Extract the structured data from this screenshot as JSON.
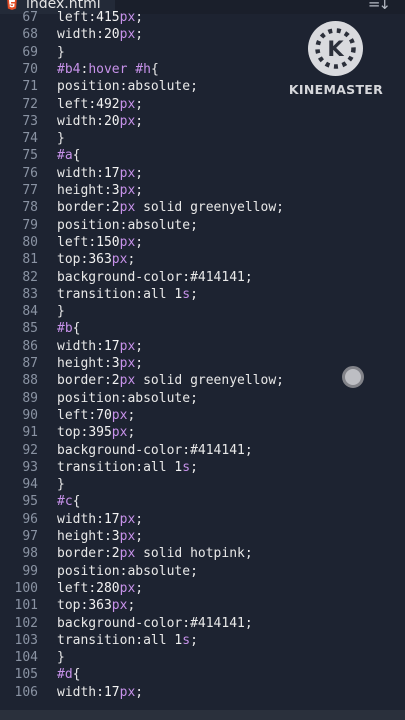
{
  "tab": {
    "title": "index.html",
    "icon": "html5-icon"
  },
  "toolbar": {
    "sort_icon": "sort-down-icon",
    "sort_glyph": "=↓"
  },
  "watermark": {
    "text": "KINEMASTER",
    "letter": "K",
    "icon": "kinemaster-logo-icon"
  },
  "editor": {
    "lines": [
      {
        "n": "67",
        "tokens": [
          [
            "prop",
            "left"
          ],
          [
            "punc",
            ":"
          ],
          [
            "num",
            "415"
          ],
          [
            "unit",
            "px"
          ],
          [
            "punc",
            ";"
          ]
        ]
      },
      {
        "n": "68",
        "tokens": [
          [
            "prop",
            "width"
          ],
          [
            "punc",
            ":"
          ],
          [
            "num",
            "20"
          ],
          [
            "unit",
            "px"
          ],
          [
            "punc",
            ";"
          ]
        ]
      },
      {
        "n": "69",
        "tokens": [
          [
            "punc",
            "}"
          ]
        ]
      },
      {
        "n": "70",
        "tokens": [
          [
            "sel",
            "#b4"
          ],
          [
            "punc",
            ":"
          ],
          [
            "sel",
            "hover"
          ],
          [
            "punc",
            " "
          ],
          [
            "sel",
            "#h"
          ],
          [
            "punc",
            "{"
          ]
        ]
      },
      {
        "n": "71",
        "tokens": [
          [
            "prop",
            "position"
          ],
          [
            "punc",
            ":"
          ],
          [
            "val",
            "absolute"
          ],
          [
            "punc",
            ";"
          ]
        ]
      },
      {
        "n": "72",
        "tokens": [
          [
            "prop",
            "left"
          ],
          [
            "punc",
            ":"
          ],
          [
            "num",
            "492"
          ],
          [
            "unit",
            "px"
          ],
          [
            "punc",
            ";"
          ]
        ]
      },
      {
        "n": "73",
        "tokens": [
          [
            "prop",
            "width"
          ],
          [
            "punc",
            ":"
          ],
          [
            "num",
            "20"
          ],
          [
            "unit",
            "px"
          ],
          [
            "punc",
            ";"
          ]
        ]
      },
      {
        "n": "74",
        "tokens": [
          [
            "punc",
            "}"
          ]
        ]
      },
      {
        "n": "75",
        "tokens": [
          [
            "sel",
            "#a"
          ],
          [
            "punc",
            "{"
          ]
        ]
      },
      {
        "n": "76",
        "tokens": [
          [
            "prop",
            "width"
          ],
          [
            "punc",
            ":"
          ],
          [
            "num",
            "17"
          ],
          [
            "unit",
            "px"
          ],
          [
            "punc",
            ";"
          ]
        ]
      },
      {
        "n": "77",
        "tokens": [
          [
            "prop",
            "height"
          ],
          [
            "punc",
            ":"
          ],
          [
            "num",
            "3"
          ],
          [
            "unit",
            "px"
          ],
          [
            "punc",
            ";"
          ]
        ]
      },
      {
        "n": "78",
        "tokens": [
          [
            "prop",
            "border"
          ],
          [
            "punc",
            ":"
          ],
          [
            "num",
            "2"
          ],
          [
            "unit",
            "px"
          ],
          [
            "val",
            " solid greenyellow"
          ],
          [
            "punc",
            ";"
          ]
        ]
      },
      {
        "n": "79",
        "tokens": [
          [
            "prop",
            "position"
          ],
          [
            "punc",
            ":"
          ],
          [
            "val",
            "absolute"
          ],
          [
            "punc",
            ";"
          ]
        ]
      },
      {
        "n": "80",
        "tokens": [
          [
            "prop",
            "left"
          ],
          [
            "punc",
            ":"
          ],
          [
            "num",
            "150"
          ],
          [
            "unit",
            "px"
          ],
          [
            "punc",
            ";"
          ]
        ]
      },
      {
        "n": "81",
        "tokens": [
          [
            "prop",
            "top"
          ],
          [
            "punc",
            ":"
          ],
          [
            "num",
            "363"
          ],
          [
            "unit",
            "px"
          ],
          [
            "punc",
            ";"
          ]
        ]
      },
      {
        "n": "82",
        "tokens": [
          [
            "prop",
            "background-color"
          ],
          [
            "punc",
            ":"
          ],
          [
            "val",
            "#414141"
          ],
          [
            "punc",
            ";"
          ]
        ]
      },
      {
        "n": "83",
        "tokens": [
          [
            "prop",
            "transition"
          ],
          [
            "punc",
            ":"
          ],
          [
            "val",
            "all "
          ],
          [
            "num",
            "1"
          ],
          [
            "unit",
            "s"
          ],
          [
            "punc",
            ";"
          ]
        ]
      },
      {
        "n": "84",
        "tokens": [
          [
            "punc",
            "}"
          ]
        ]
      },
      {
        "n": "85",
        "tokens": [
          [
            "sel",
            "#b"
          ],
          [
            "punc",
            "{"
          ]
        ]
      },
      {
        "n": "86",
        "tokens": [
          [
            "prop",
            "width"
          ],
          [
            "punc",
            ":"
          ],
          [
            "num",
            "17"
          ],
          [
            "unit",
            "px"
          ],
          [
            "punc",
            ";"
          ]
        ]
      },
      {
        "n": "87",
        "tokens": [
          [
            "prop",
            "height"
          ],
          [
            "punc",
            ":"
          ],
          [
            "num",
            "3"
          ],
          [
            "unit",
            "px"
          ],
          [
            "punc",
            ";"
          ]
        ]
      },
      {
        "n": "88",
        "tokens": [
          [
            "prop",
            "border"
          ],
          [
            "punc",
            ":"
          ],
          [
            "num",
            "2"
          ],
          [
            "unit",
            "px"
          ],
          [
            "val",
            " solid greenyellow"
          ],
          [
            "punc",
            ";"
          ]
        ]
      },
      {
        "n": "89",
        "tokens": [
          [
            "prop",
            "position"
          ],
          [
            "punc",
            ":"
          ],
          [
            "val",
            "absolute"
          ],
          [
            "punc",
            ";"
          ]
        ]
      },
      {
        "n": "90",
        "tokens": [
          [
            "prop",
            "left"
          ],
          [
            "punc",
            ":"
          ],
          [
            "num",
            "70"
          ],
          [
            "unit",
            "px"
          ],
          [
            "punc",
            ";"
          ]
        ]
      },
      {
        "n": "91",
        "tokens": [
          [
            "prop",
            "top"
          ],
          [
            "punc",
            ":"
          ],
          [
            "num",
            "395"
          ],
          [
            "unit",
            "px"
          ],
          [
            "punc",
            ";"
          ]
        ]
      },
      {
        "n": "92",
        "tokens": [
          [
            "prop",
            "background-color"
          ],
          [
            "punc",
            ":"
          ],
          [
            "val",
            "#414141"
          ],
          [
            "punc",
            ";"
          ]
        ]
      },
      {
        "n": "93",
        "tokens": [
          [
            "prop",
            "transition"
          ],
          [
            "punc",
            ":"
          ],
          [
            "val",
            "all "
          ],
          [
            "num",
            "1"
          ],
          [
            "unit",
            "s"
          ],
          [
            "punc",
            ";"
          ]
        ]
      },
      {
        "n": "94",
        "tokens": [
          [
            "punc",
            "}"
          ]
        ]
      },
      {
        "n": "95",
        "tokens": [
          [
            "sel",
            "#c"
          ],
          [
            "punc",
            "{"
          ]
        ]
      },
      {
        "n": "96",
        "tokens": [
          [
            "prop",
            "width"
          ],
          [
            "punc",
            ":"
          ],
          [
            "num",
            "17"
          ],
          [
            "unit",
            "px"
          ],
          [
            "punc",
            ";"
          ]
        ]
      },
      {
        "n": "97",
        "tokens": [
          [
            "prop",
            "height"
          ],
          [
            "punc",
            ":"
          ],
          [
            "num",
            "3"
          ],
          [
            "unit",
            "px"
          ],
          [
            "punc",
            ";"
          ]
        ]
      },
      {
        "n": "98",
        "tokens": [
          [
            "prop",
            "border"
          ],
          [
            "punc",
            ":"
          ],
          [
            "num",
            "2"
          ],
          [
            "unit",
            "px"
          ],
          [
            "val",
            " solid hotpink"
          ],
          [
            "punc",
            ";"
          ]
        ]
      },
      {
        "n": "99",
        "tokens": [
          [
            "prop",
            "position"
          ],
          [
            "punc",
            ":"
          ],
          [
            "val",
            "absolute"
          ],
          [
            "punc",
            ";"
          ]
        ]
      },
      {
        "n": "100",
        "tokens": [
          [
            "prop",
            "left"
          ],
          [
            "punc",
            ":"
          ],
          [
            "num",
            "280"
          ],
          [
            "unit",
            "px"
          ],
          [
            "punc",
            ";"
          ]
        ]
      },
      {
        "n": "101",
        "tokens": [
          [
            "prop",
            "top"
          ],
          [
            "punc",
            ":"
          ],
          [
            "num",
            "363"
          ],
          [
            "unit",
            "px"
          ],
          [
            "punc",
            ";"
          ]
        ]
      },
      {
        "n": "102",
        "tokens": [
          [
            "prop",
            "background-color"
          ],
          [
            "punc",
            ":"
          ],
          [
            "val",
            "#414141"
          ],
          [
            "punc",
            ";"
          ]
        ]
      },
      {
        "n": "103",
        "tokens": [
          [
            "prop",
            "transition"
          ],
          [
            "punc",
            ":"
          ],
          [
            "val",
            "all "
          ],
          [
            "num",
            "1"
          ],
          [
            "unit",
            "s"
          ],
          [
            "punc",
            ";"
          ]
        ]
      },
      {
        "n": "104",
        "tokens": [
          [
            "punc",
            "}"
          ]
        ]
      },
      {
        "n": "105",
        "tokens": [
          [
            "sel",
            "#d"
          ],
          [
            "punc",
            "{"
          ]
        ]
      },
      {
        "n": "106",
        "tokens": [
          [
            "prop",
            "width"
          ],
          [
            "punc",
            ":"
          ],
          [
            "num",
            "17"
          ],
          [
            "unit",
            "px"
          ],
          [
            "punc",
            ";"
          ]
        ]
      }
    ]
  },
  "colors": {
    "background": "#1d2331",
    "selector": "#c792ea",
    "line_number": "#8a93a3",
    "text": "#e8e8e8"
  }
}
